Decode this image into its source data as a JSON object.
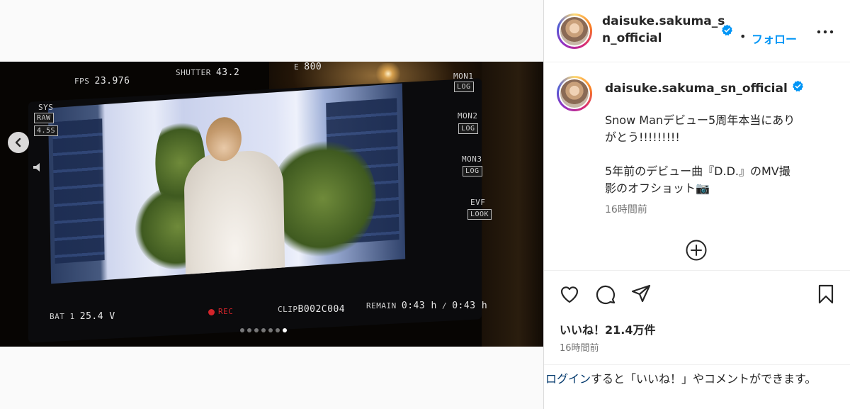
{
  "post": {
    "username": "daisuke.sakuma_sn_official",
    "username_line1": "daisuke.sakuma_s",
    "username_line2": "n_official",
    "follow_label": "フォロー",
    "caption_line1": "Snow Manデビュー5周年本当にあり\nがとう!!!!!!!!!",
    "caption_line2": "5年前のデビュー曲『D.D.』のMV撮\n影のオフショット📷",
    "comment_time": "16時間前",
    "likes": "いいね！21.4万件",
    "post_time": "16時間前",
    "login_link": "ログイン",
    "login_rest": "すると「いいね！」やコメントができます。"
  },
  "carousel": {
    "total": 7,
    "active_index": 6
  },
  "hud": {
    "fps_label": "FPS",
    "fps": "23.976",
    "shutter_label": "SHUTTER",
    "shutter": "43.2",
    "ei_label": "E",
    "ei": "800",
    "sys_label": "SYS",
    "raw": "RAW",
    "ratio": "4.5S",
    "mon1": "MON1",
    "mon2": "MON2",
    "mon3": "MON3",
    "evf": "EVF",
    "log": "LOG",
    "look": "LOOK",
    "bat_label": "BAT 1",
    "bat": "25.4 V",
    "rec": "REC",
    "clip_label": "CLIP",
    "clip": "B002C004",
    "remain_label": "REMAIN",
    "remain1": "0:43 h",
    "slash": "/",
    "remain2": "0:43 h"
  },
  "colors": {
    "follow": "#0095f6",
    "verified": "#0095f6",
    "rec": "#d3242a"
  },
  "icons": [
    "chevron-left-icon",
    "verified-icon",
    "more-icon",
    "add-circle-icon",
    "heart-icon",
    "comment-icon",
    "share-icon",
    "bookmark-icon"
  ]
}
